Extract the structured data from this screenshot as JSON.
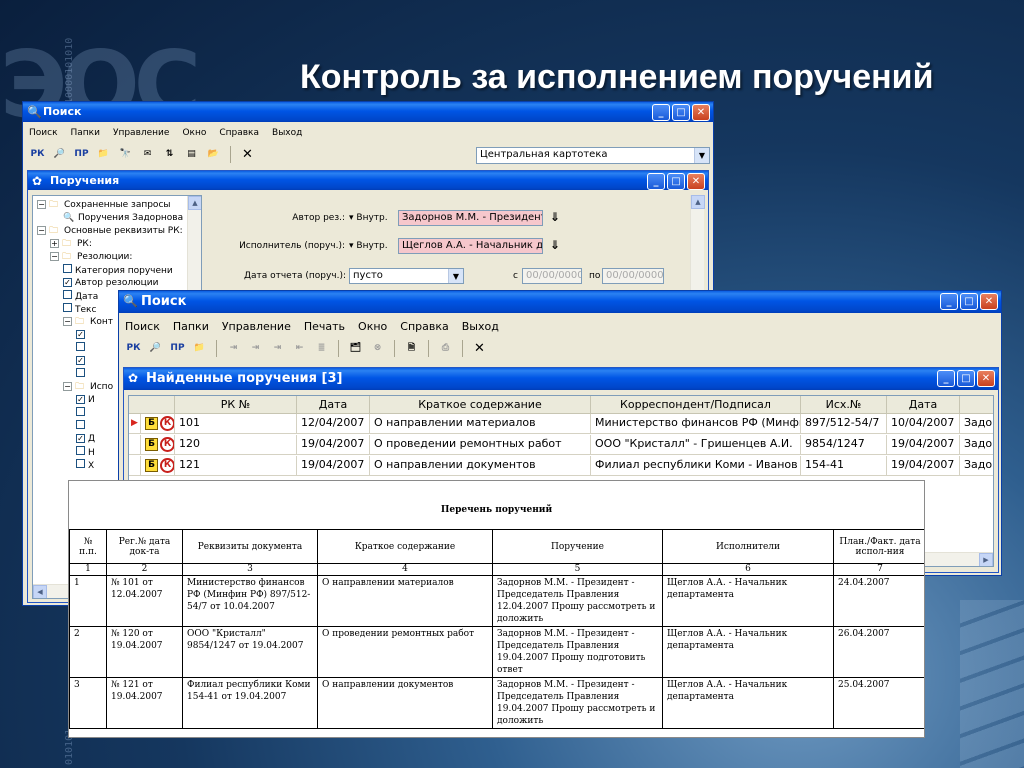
{
  "slide": {
    "title": "Контроль за исполнением поручений",
    "background_logo": "ЭОС",
    "background_bits_1": "110000101010",
    "background_bits_2": "010101"
  },
  "colors": {
    "xp_title": "#0055e5",
    "pink_field": "#f6c7cc",
    "badge_yellow": "#ffde3a",
    "badge_red": "#c8201b"
  },
  "main_window": {
    "title": "Поиск",
    "icon": "magnifier-icon",
    "menu": [
      "Поиск",
      "Папки",
      "Управление",
      "Окно",
      "Справка",
      "Выход"
    ],
    "toolbar": {
      "rk": "РК",
      "search": "search-icon",
      "pr": "ПР",
      "folder": "folder-icon",
      "binoculars": "binoculars-icon",
      "mail": "mail-icon",
      "sort": "sort-icon",
      "form": "form-icon",
      "open": "open-folder-icon",
      "close": "✕"
    },
    "catalog_combo": "Центральная картотека"
  },
  "assignments_window": {
    "title": "Поручения",
    "tree": [
      {
        "label": "Сохраненные запросы",
        "level": 0,
        "expander": "−",
        "icon": "folder-icon"
      },
      {
        "label": "Поручения Задорнова",
        "level": 1,
        "expander": "",
        "icon": "search-icon"
      },
      {
        "label": "Основные реквизиты РК:",
        "level": 0,
        "expander": "−",
        "icon": "folder-icon"
      },
      {
        "label": "РК:",
        "level": 1,
        "expander": "+",
        "icon": "folder-icon"
      },
      {
        "label": "Резолюции:",
        "level": 1,
        "expander": "−",
        "icon": "folder-icon"
      },
      {
        "label": "Категория поручени",
        "level": 2,
        "expander": "",
        "check": ""
      },
      {
        "label": "Автор резолюции",
        "level": 2,
        "expander": "",
        "check": "✓"
      },
      {
        "label": "Дата",
        "level": 2,
        "expander": "",
        "check": ""
      },
      {
        "label": "Текс",
        "level": 2,
        "expander": "",
        "check": ""
      },
      {
        "label": "Конт",
        "level": 2,
        "expander": "−",
        "icon": "folder-icon"
      },
      {
        "label": "",
        "level": 3,
        "expander": "",
        "check": "✓"
      },
      {
        "label": "",
        "level": 3,
        "expander": "",
        "check": ""
      },
      {
        "label": "",
        "level": 3,
        "expander": "",
        "check": "✓"
      },
      {
        "label": "",
        "level": 3,
        "expander": "",
        "check": ""
      },
      {
        "label": "Испо",
        "level": 2,
        "expander": "−",
        "icon": "folder-icon"
      },
      {
        "label": "И",
        "level": 3,
        "expander": "",
        "check": "✓"
      },
      {
        "label": "",
        "level": 3,
        "expander": "",
        "check": ""
      },
      {
        "label": "",
        "level": 3,
        "expander": "",
        "check": ""
      },
      {
        "label": "Д",
        "level": 3,
        "expander": "",
        "check": "✓"
      },
      {
        "label": "Н",
        "level": 3,
        "expander": "",
        "check": ""
      },
      {
        "label": "Х",
        "level": 3,
        "expander": "",
        "check": ""
      }
    ],
    "form": {
      "author_label": "Автор рез.:",
      "author_mode": "Внутр.",
      "author_value": "Задорнов М.М. - Президент",
      "executor_label": "Исполнитель (поруч.):",
      "executor_mode": "Внутр.",
      "executor_value": "Щеглов А.А. - Начальник де",
      "report_date_label": "Дата отчета (поруч.):",
      "report_date_value": "пусто",
      "from_label": "с",
      "from_value": "00/00/0000",
      "to_label": "по",
      "to_value": "00/00/0000"
    }
  },
  "front_window": {
    "title": "Поиск",
    "menu": [
      "Поиск",
      "Папки",
      "Управление",
      "Печать",
      "Окно",
      "Справка",
      "Выход"
    ],
    "toolbar": {
      "rk": "РК",
      "search": "search-icon",
      "pr": "ПР",
      "folder": "new-folder-icon",
      "close": "✕"
    }
  },
  "found_window": {
    "title": "Найденные поручения",
    "count": "[3]",
    "columns": [
      "РК №",
      "Дата",
      "Краткое содержание",
      "Корреспондент/Подписал",
      "Исх.№",
      "Дата",
      ""
    ],
    "rows": [
      {
        "marker": "▶",
        "b": "Б",
        "k": "К",
        "rk": "101",
        "date": "12/04/2007",
        "summary": "О направлении материалов",
        "correspondent": "Министерство финансов РФ (Минфин РФ)",
        "out_no": "897/512-54/7",
        "out_date": "10/04/2007",
        "extra": "Задорнов"
      },
      {
        "marker": "",
        "b": "Б",
        "k": "К",
        "rk": "120",
        "date": "19/04/2007",
        "summary": "О проведении ремонтных работ",
        "correspondent": "ООО \"Кристалл\" - Гришенцев А.И.",
        "out_no": "9854/1247",
        "out_date": "19/04/2007",
        "extra": "Задорнов"
      },
      {
        "marker": "",
        "b": "Б",
        "k": "К",
        "rk": "121",
        "date": "19/04/2007",
        "summary": "О направлении документов",
        "correspondent": "Филиал республики Коми - Иванов",
        "out_no": "154-41",
        "out_date": "19/04/2007",
        "extra": "Задорнов"
      }
    ]
  },
  "report": {
    "title": "Перечень поручений",
    "columns": [
      "№ п.п.",
      "Рег.№ дата док-та",
      "Реквизиты документа",
      "Краткое содержание",
      "Поручение",
      "Исполнители",
      "План./Факт. дата испол-ния"
    ],
    "column_numbers": [
      "1",
      "2",
      "3",
      "4",
      "5",
      "6",
      "7"
    ],
    "rows": [
      {
        "n": "1",
        "reg": "№ 101 от 12.04.2007",
        "requisites": "Министерство финансов РФ (Минфин РФ) 897/512-54/7 от 10.04.2007",
        "summary": "О направлении материалов",
        "assignment": "Задорнов М.М. - Президент - Председатель Правления 12.04.2007 Прошу рассмотреть и доложить",
        "executors": "Щеглов А.А. - Начальник департамента",
        "date": "24.04.2007"
      },
      {
        "n": "2",
        "reg": "№ 120 от 19.04.2007",
        "requisites": "ООО \"Кристалл\" 9854/1247 от 19.04.2007",
        "summary": "О проведении ремонтных работ",
        "assignment": "Задорнов М.М. - Президент - Председатель Правления 19.04.2007 Прошу подготовить ответ",
        "executors": "Щеглов А.А. - Начальник департамента",
        "date": "26.04.2007"
      },
      {
        "n": "3",
        "reg": "№ 121 от 19.04.2007",
        "requisites": "Филиал республики Коми 154-41 от 19.04.2007",
        "summary": "О направлении документов",
        "assignment": "Задорнов М.М. - Президент - Председатель Правления 19.04.2007 Прошу рассмотреть и доложить",
        "executors": "Щеглов А.А. - Начальник департамента",
        "date": "25.04.2007"
      }
    ]
  }
}
